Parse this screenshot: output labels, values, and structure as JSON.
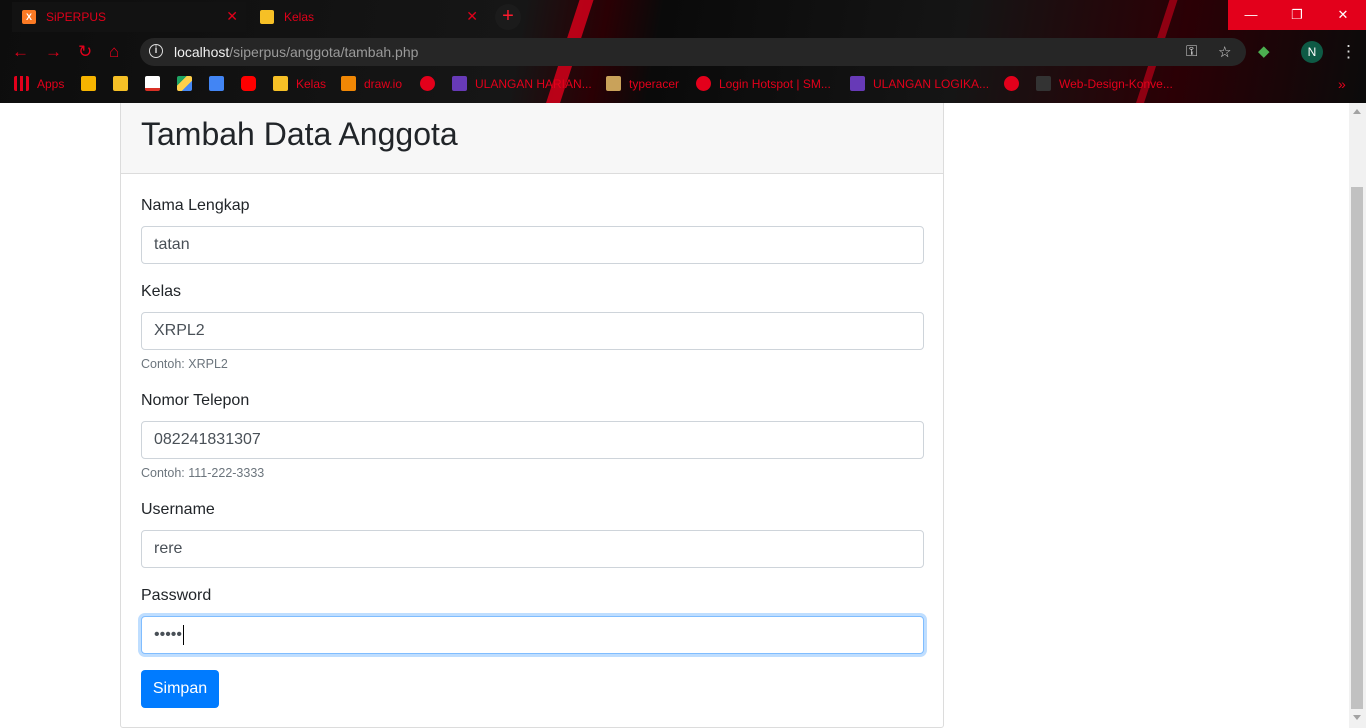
{
  "browser": {
    "tabs": [
      {
        "title": "SiPERPUS",
        "active": true
      },
      {
        "title": "Kelas",
        "active": false
      }
    ],
    "new_tab_symbol": "+",
    "window_controls": {
      "minimize": "—",
      "restore": "❐",
      "close": "✕"
    },
    "address": {
      "host": "localhost",
      "path": "/siperpus/anggota/tambah.php"
    },
    "profile_initial": "N",
    "bookmarks": [
      {
        "label": "Apps",
        "icon": "apps-grid-icon",
        "color": "#e3001b"
      },
      {
        "label": "",
        "icon": "google-keep-icon",
        "color": "#f6b400"
      },
      {
        "label": "",
        "icon": "google-classroom-icon",
        "color": "#f6c026"
      },
      {
        "label": "",
        "icon": "gmail-icon",
        "color": "#d93025"
      },
      {
        "label": "",
        "icon": "google-drive-icon",
        "color": "#1fa463"
      },
      {
        "label": "",
        "icon": "google-docs-icon",
        "color": "#4285f4"
      },
      {
        "label": "",
        "icon": "youtube-icon",
        "color": "#ff0000"
      },
      {
        "label": "Kelas",
        "icon": "google-classroom-icon",
        "color": "#f6c026"
      },
      {
        "label": "draw.io",
        "icon": "drawio-icon",
        "color": "#f08705"
      },
      {
        "label": "",
        "icon": "globe-icon",
        "color": "#e3001b"
      },
      {
        "label": "ULANGAN HARIAN...",
        "icon": "google-forms-icon",
        "color": "#673ab7"
      },
      {
        "label": "typeracer",
        "icon": "typeracer-icon",
        "color": "#c9a25a"
      },
      {
        "label": "Login Hotspot | SM...",
        "icon": "globe-icon",
        "color": "#e3001b"
      },
      {
        "label": "ULANGAN LOGIKA...",
        "icon": "google-forms-icon",
        "color": "#673ab7"
      },
      {
        "label": "",
        "icon": "globe-icon",
        "color": "#e3001b"
      },
      {
        "label": "Web-Design-Konve...",
        "icon": "file-icon",
        "color": "#333333"
      }
    ]
  },
  "form": {
    "title": "Tambah Data Anggota",
    "fields": [
      {
        "label": "Nama Lengkap",
        "value": "tatan",
        "help": ""
      },
      {
        "label": "Kelas",
        "value": "XRPL2",
        "help": "Contoh: XRPL2"
      },
      {
        "label": "Nomor Telepon",
        "value": "082241831307",
        "help": "Contoh: 111-222-3333"
      },
      {
        "label": "Username",
        "value": "rere",
        "help": ""
      },
      {
        "label": "Password",
        "value": "•••••",
        "help": "",
        "focused": true
      }
    ],
    "submit_label": "Simpan"
  },
  "colors": {
    "accent": "#e3001b",
    "primary_button": "#007bff",
    "card_header_bg": "#f7f7f7"
  }
}
